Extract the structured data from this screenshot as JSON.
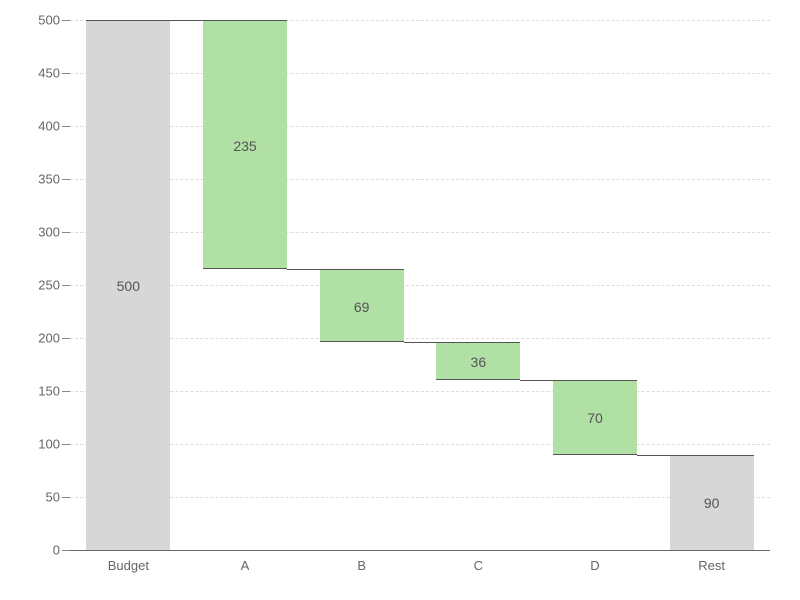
{
  "chart_data": {
    "type": "bar",
    "subtype": "waterfall",
    "categories": [
      "Budget",
      "A",
      "B",
      "C",
      "D",
      "Rest"
    ],
    "bars": [
      {
        "name": "Budget",
        "kind": "total",
        "base": 0,
        "top": 500,
        "label": "500"
      },
      {
        "name": "A",
        "kind": "delta",
        "base": 265,
        "top": 500,
        "label": "235"
      },
      {
        "name": "B",
        "kind": "delta",
        "base": 196,
        "top": 265,
        "label": "69"
      },
      {
        "name": "C",
        "kind": "delta",
        "base": 160,
        "top": 196,
        "label": "36"
      },
      {
        "name": "D",
        "kind": "delta",
        "base": 90,
        "top": 160,
        "label": "70"
      },
      {
        "name": "Rest",
        "kind": "total",
        "base": 0,
        "top": 90,
        "label": "90"
      }
    ],
    "y_ticks": [
      0,
      50,
      100,
      150,
      200,
      250,
      300,
      350,
      400,
      450,
      500
    ],
    "ylim": [
      0,
      500
    ],
    "xlabel": "",
    "ylabel": "",
    "title": ""
  },
  "colors": {
    "total_fill": "#d7d7d7",
    "delta_fill": "#b1e0a4",
    "edge": "#555555",
    "grid": "#dddddd"
  }
}
